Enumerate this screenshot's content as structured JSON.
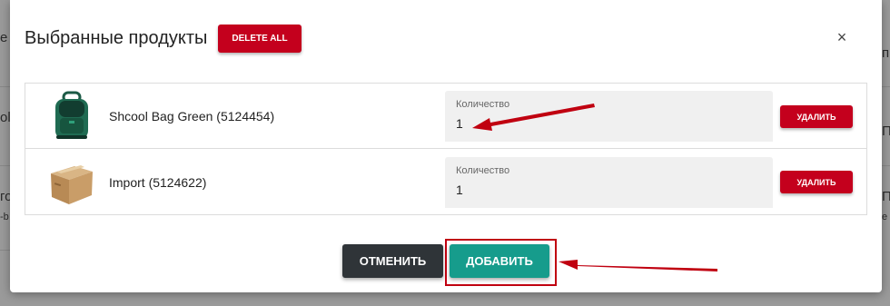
{
  "modal": {
    "title": "Выбранные продукты",
    "delete_all_label": "DELETE ALL",
    "close_glyph": "×"
  },
  "products": [
    {
      "name": "Shcool Bag Green (5124454)",
      "icon": "green-backpack-image",
      "quantity_label": "Количество",
      "quantity_value": "1",
      "remove_label": "УДАЛИТЬ"
    },
    {
      "name": "Import (5124622)",
      "icon": "cardboard-box-image",
      "quantity_label": "Количество",
      "quantity_value": "1",
      "remove_label": "УДАЛИТЬ"
    }
  ],
  "footer": {
    "cancel_label": "ОТМЕНИТЬ",
    "add_label": "ДОБАВИТЬ"
  },
  "background": {
    "left_fragments": [
      "e",
      "ol",
      "го",
      "-b"
    ],
    "right_fragments": [
      "п",
      "П",
      "П",
      "e"
    ]
  },
  "colors": {
    "danger": "#c4001d",
    "primary": "#169c8c",
    "dark": "#2f3438",
    "annotation": "#c00010"
  }
}
